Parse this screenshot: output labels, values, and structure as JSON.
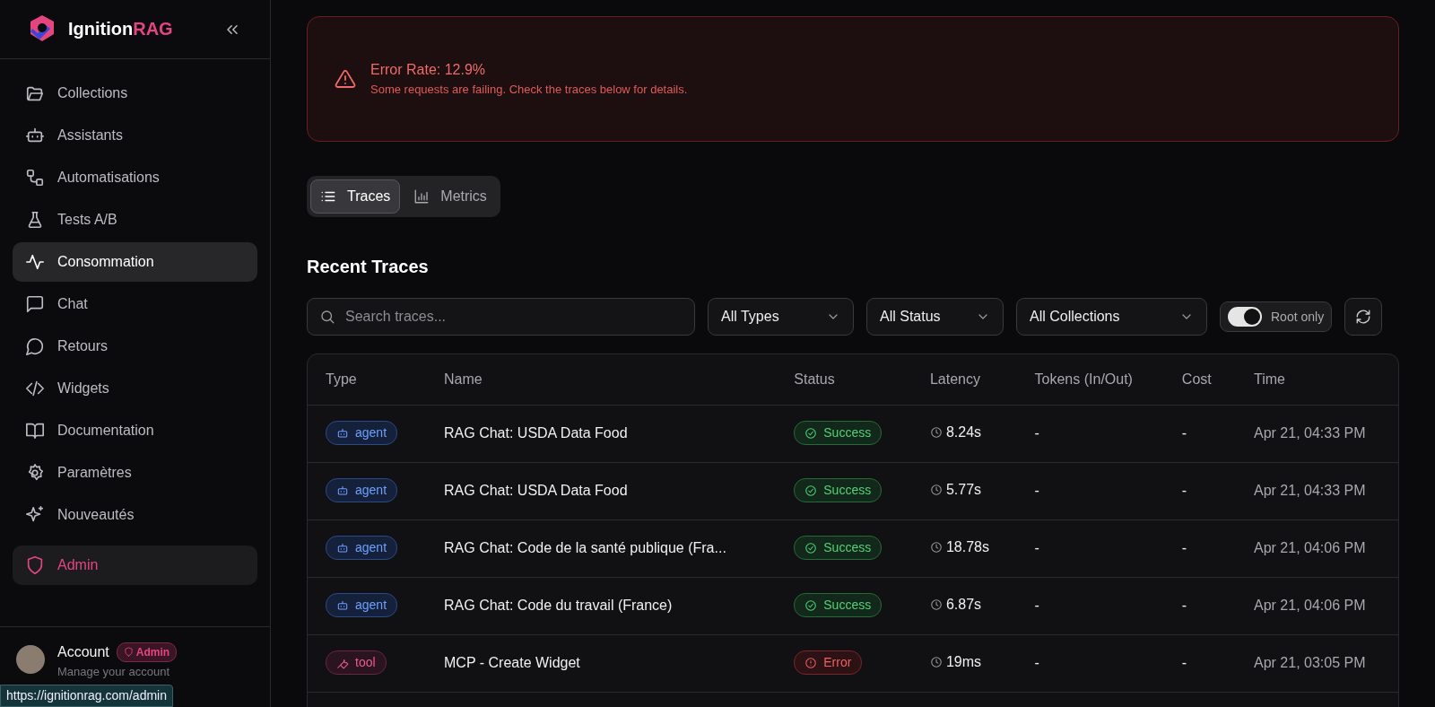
{
  "brand": {
    "name": "Ignition",
    "accent": "RAG"
  },
  "sidebar": {
    "items": [
      {
        "label": "Collections",
        "kind": "normal",
        "selected": false
      },
      {
        "label": "Assistants",
        "kind": "normal",
        "selected": false
      },
      {
        "label": "Automatisations",
        "kind": "normal",
        "selected": false
      },
      {
        "label": "Tests A/B",
        "kind": "normal",
        "selected": false
      },
      {
        "label": "Consommation",
        "kind": "normal",
        "selected": true
      },
      {
        "label": "Chat",
        "kind": "normal",
        "selected": false
      },
      {
        "label": "Retours",
        "kind": "normal",
        "selected": false
      },
      {
        "label": "Widgets",
        "kind": "normal",
        "selected": false
      },
      {
        "label": "Documentation",
        "kind": "normal",
        "selected": false
      },
      {
        "label": "Paramètres",
        "kind": "normal",
        "selected": false
      },
      {
        "label": "Nouveautés",
        "kind": "normal",
        "selected": false
      },
      {
        "label": "Admin",
        "kind": "admin",
        "selected": false
      }
    ]
  },
  "account": {
    "title": "Account",
    "badge": "Admin",
    "subtitle": "Manage your account"
  },
  "status_url": "https://ignitionrag.com/admin",
  "alert": {
    "title": "Error Rate: 12.9%",
    "message": "Some requests are failing. Check the traces below for details."
  },
  "view_tabs": [
    {
      "label": "Traces",
      "selected": true
    },
    {
      "label": "Metrics",
      "selected": false
    }
  ],
  "section_title": "Recent Traces",
  "filters": {
    "search": {
      "placeholder": "Search traces..."
    },
    "dropdowns": [
      "All Types",
      "All Status",
      "All Collections"
    ],
    "toggle": {
      "label": "Root only",
      "on": true
    }
  },
  "table": {
    "columns": [
      "Type",
      "Name",
      "Status",
      "Latency",
      "Tokens (In/Out)",
      "Cost",
      "Time"
    ],
    "rows": [
      {
        "type": {
          "label": "agent",
          "kind": "agent"
        },
        "name": "RAG Chat: USDA Data Food",
        "status": {
          "label": "Success",
          "kind": "success"
        },
        "latency": "8.24s",
        "tokens": "-",
        "cost": "-",
        "time": "Apr 21, 04:33 PM"
      },
      {
        "type": {
          "label": "agent",
          "kind": "agent"
        },
        "name": "RAG Chat: USDA Data Food",
        "status": {
          "label": "Success",
          "kind": "success"
        },
        "latency": "5.77s",
        "tokens": "-",
        "cost": "-",
        "time": "Apr 21, 04:33 PM"
      },
      {
        "type": {
          "label": "agent",
          "kind": "agent"
        },
        "name": "RAG Chat: Code de la santé publique (Fra...",
        "status": {
          "label": "Success",
          "kind": "success"
        },
        "latency": "18.78s",
        "tokens": "-",
        "cost": "-",
        "time": "Apr 21, 04:06 PM"
      },
      {
        "type": {
          "label": "agent",
          "kind": "agent"
        },
        "name": "RAG Chat: Code du travail (France)",
        "status": {
          "label": "Success",
          "kind": "success"
        },
        "latency": "6.87s",
        "tokens": "-",
        "cost": "-",
        "time": "Apr 21, 04:06 PM"
      },
      {
        "type": {
          "label": "tool",
          "kind": "tool"
        },
        "name": "MCP - Create Widget",
        "status": {
          "label": "Error",
          "kind": "error"
        },
        "latency": "19ms",
        "tokens": "-",
        "cost": "-",
        "time": "Apr 21, 03:05 PM"
      }
    ]
  }
}
